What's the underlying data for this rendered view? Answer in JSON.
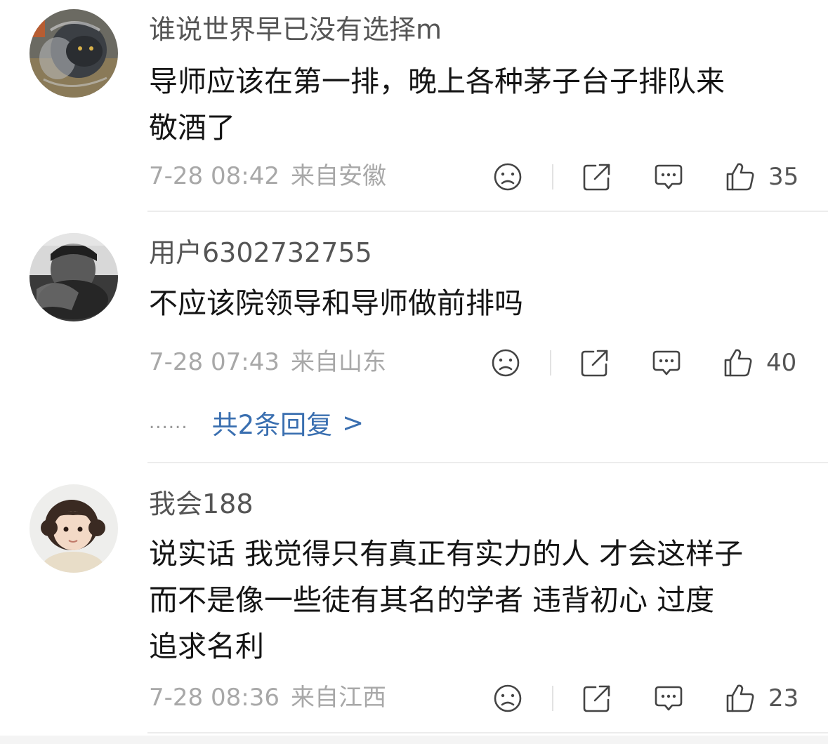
{
  "comments": [
    {
      "username": "谁说世界早已没有选择m",
      "lines": [
        "导师应该在第一排，晚上各种茅子台子排队来",
        "敬酒了"
      ],
      "time": "7-28 08:42",
      "location": "来自安徽",
      "likes": "35",
      "avatar_icon": "cat-photo"
    },
    {
      "username": "用户6302732755",
      "lines": [
        "不应该院领导和导师做前排吗"
      ],
      "time": "7-28 07:43",
      "location": "来自山东",
      "likes": "40",
      "replies_dots": "......",
      "replies_link": "共2条回复",
      "replies_chevron": ">",
      "avatar_icon": "man-photo"
    },
    {
      "username": "我会188",
      "lines": [
        "说实话 我觉得只有真正有实力的人 才会这样子",
        "而不是像一些徒有其名的学者  违背初心  过度",
        "追求名利"
      ],
      "time": "7-28 08:36",
      "location": "来自江西",
      "likes": "23",
      "avatar_icon": "child-photo"
    }
  ],
  "icons": {
    "dislike": "sad-face-icon",
    "share": "share-icon",
    "reply": "comment-icon",
    "like": "thumbs-up-icon"
  },
  "colors": {
    "link": "#3a6fb0",
    "meta": "#a8a8a8",
    "username": "#555555"
  }
}
